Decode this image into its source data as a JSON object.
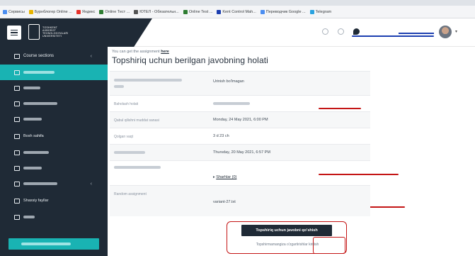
{
  "browser": {
    "bookmarks": [
      "Сервисы",
      "Бурнблогер Online ...",
      "Яндекс",
      "Online Тест ...",
      "ЮТЕЛ - Обязательн...",
      "Online Test ...",
      "Kent Control Mah...",
      "Переводчик Google ...",
      "Telegram"
    ]
  },
  "header": {
    "logo_text": "TOSHKENT\nAXBOROT\nTEXNOLOGIYALARI\nUNIVERSITETI"
  },
  "sidebar": {
    "items": [
      {
        "label": "Course sections"
      },
      {
        "label": ""
      },
      {
        "label": ""
      },
      {
        "label": ""
      },
      {
        "label": ""
      },
      {
        "label": "Bosh sahifa"
      },
      {
        "label": ""
      },
      {
        "label": ""
      },
      {
        "label": ""
      },
      {
        "label": "Shaxsiy fayllar"
      },
      {
        "label": ""
      }
    ]
  },
  "main": {
    "hint_text": "You can get the assignment ",
    "hint_link": "here",
    "title": "Topshiriq uchun berilgan javobning holati",
    "rows": [
      {
        "label": "",
        "value": "Urinish bo'lmagan"
      },
      {
        "label": "Baholash holati",
        "value": ""
      },
      {
        "label": "Qabul qilishni muddat sanasi",
        "value": "Monday, 24 May 2021, 6:00 PM"
      },
      {
        "label": "Qolgan vaqt",
        "value": "3 d 23 ch"
      },
      {
        "label": "",
        "value": "Thursday, 20 May 2021, 6:57 PM"
      },
      {
        "label": "",
        "value": "Sharhlar (0)"
      },
      {
        "label": "Random assignment",
        "value": "variant-27.txt"
      }
    ],
    "submit_button": "Topshiriq uchun javobni qo'shish",
    "submit_note": "Topshirmamangiza o'zgartirishlar kiritish"
  }
}
